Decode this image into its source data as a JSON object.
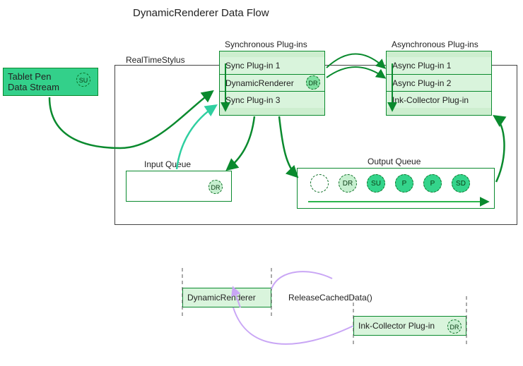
{
  "title": "DynamicRenderer Data Flow",
  "tablet_pen": {
    "label": "Tablet Pen\nData Stream",
    "badge": "SU"
  },
  "rts_label": "RealTimeStylus",
  "sync": {
    "heading": "Synchronous Plug-ins",
    "rows": [
      {
        "label": "Sync Plug-in 1"
      },
      {
        "label": "DynamicRenderer",
        "badge": "DR"
      },
      {
        "label": "Sync Plug-in 3"
      }
    ]
  },
  "async": {
    "heading": "Asynchronous Plug-ins",
    "rows": [
      {
        "label": "Async Plug-in 1"
      },
      {
        "label": "Async Plug-in 2"
      },
      {
        "label": "Ink-Collector Plug-in"
      }
    ]
  },
  "input_queue": {
    "label": "Input Queue",
    "badge": "DR"
  },
  "output_queue": {
    "label": "Output Queue",
    "items": [
      {
        "label": "",
        "style": "empty"
      },
      {
        "label": "DR",
        "style": "pale"
      },
      {
        "label": "SU",
        "style": "bright"
      },
      {
        "label": "P",
        "style": "bright"
      },
      {
        "label": "P",
        "style": "bright"
      },
      {
        "label": "SD",
        "style": "bright"
      }
    ]
  },
  "bottom": {
    "dynamic_renderer": "DynamicRenderer",
    "release_cached_data": "ReleaseCachedData()",
    "ink_collector": "Ink-Collector Plug-in",
    "ink_badge": "DR"
  },
  "colors": {
    "green_dark": "#0a8a2e",
    "green_border": "#0a6d23",
    "green_bright": "#33d08a",
    "purple": "#c9a6f5"
  }
}
